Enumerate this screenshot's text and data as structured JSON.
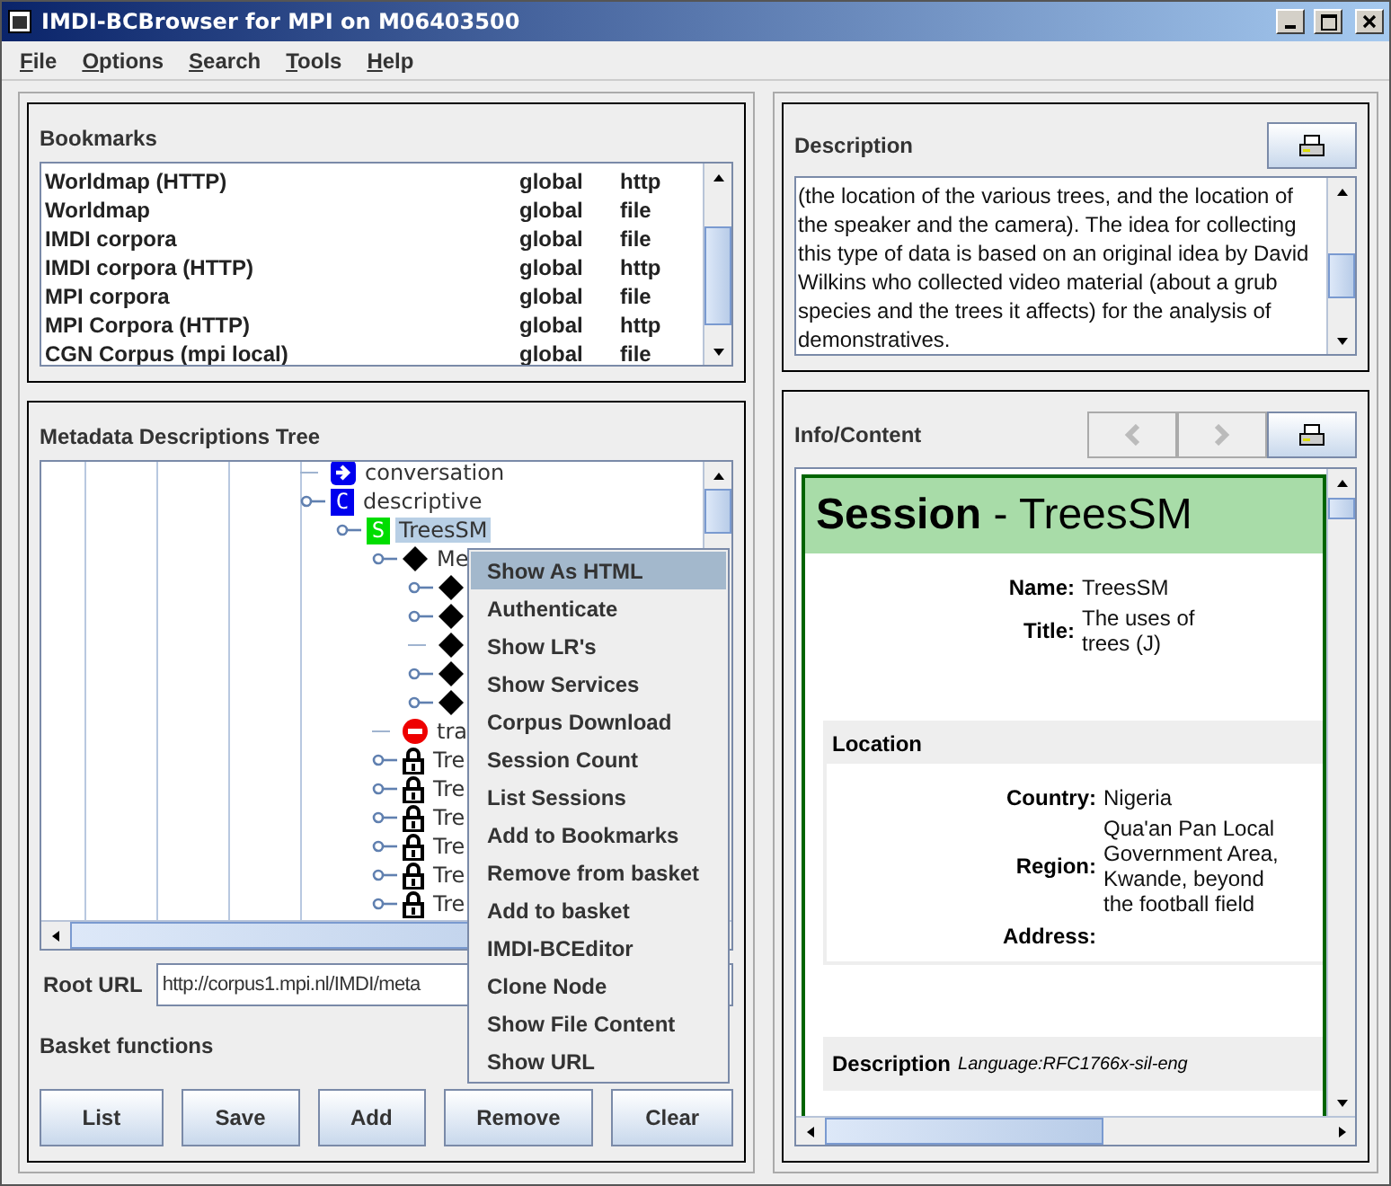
{
  "window": {
    "title": "IMDI-BCBrowser for MPI on M06403500"
  },
  "menu": [
    {
      "label": "File"
    },
    {
      "label": "Options"
    },
    {
      "label": "Search"
    },
    {
      "label": "Tools"
    },
    {
      "label": "Help"
    }
  ],
  "bookmarks": {
    "title": "Bookmarks",
    "rows": [
      {
        "name": "Worldmap (HTTP)",
        "scope": "global",
        "type": "http"
      },
      {
        "name": "Worldmap",
        "scope": "global",
        "type": "file"
      },
      {
        "name": "IMDI corpora",
        "scope": "global",
        "type": "file"
      },
      {
        "name": "IMDI corpora (HTTP)",
        "scope": "global",
        "type": "http"
      },
      {
        "name": "MPI corpora",
        "scope": "global",
        "type": "file"
      },
      {
        "name": "MPI Corpora (HTTP)",
        "scope": "global",
        "type": "http"
      },
      {
        "name": "CGN Corpus (mpi local)",
        "scope": "global",
        "type": "file"
      }
    ]
  },
  "tree": {
    "title": "Metadata Descriptions Tree",
    "nodes": [
      {
        "kind": "link",
        "label": "conversation",
        "expandable": false,
        "selected": false
      },
      {
        "kind": "corpus",
        "badge": "C",
        "label": "descriptive",
        "expandable": true,
        "selected": false,
        "children": [
          {
            "kind": "session",
            "badge": "S",
            "label": "TreesSM",
            "expandable": true,
            "selected": true,
            "children": [
              {
                "kind": "metadata",
                "label": "Me",
                "expandable": true,
                "selected": false,
                "children": [
                  {
                    "kind": "metadata",
                    "expandable": true
                  },
                  {
                    "kind": "metadata",
                    "expandable": true
                  },
                  {
                    "kind": "metadata",
                    "expandable": false
                  },
                  {
                    "kind": "metadata",
                    "expandable": true
                  },
                  {
                    "kind": "metadata",
                    "expandable": true
                  }
                ]
              },
              {
                "kind": "blocked",
                "label": "tra",
                "expandable": false,
                "selected": false
              },
              {
                "kind": "locked",
                "label": "Tre",
                "expandable": true,
                "selected": false
              },
              {
                "kind": "locked",
                "label": "Tre",
                "expandable": true,
                "selected": false
              },
              {
                "kind": "locked",
                "label": "Tre",
                "expandable": true,
                "selected": false
              },
              {
                "kind": "locked",
                "label": "Tre",
                "expandable": true,
                "selected": false
              },
              {
                "kind": "locked",
                "label": "Tre",
                "expandable": true,
                "selected": false
              },
              {
                "kind": "locked",
                "label": "Tre",
                "expandable": true,
                "selected": false
              }
            ]
          }
        ]
      }
    ]
  },
  "root_url": {
    "label": "Root URL",
    "value": "http://corpus1.mpi.nl/IMDI/meta"
  },
  "basket": {
    "title": "Basket functions",
    "buttons": [
      "List",
      "Save",
      "Add",
      "Remove",
      "Clear"
    ]
  },
  "context_menu": {
    "items": [
      {
        "label": "Show As HTML",
        "selected": true
      },
      {
        "label": "Authenticate",
        "selected": false
      },
      {
        "label": "Show LR's",
        "selected": false
      },
      {
        "label": "Show Services",
        "selected": false
      },
      {
        "label": "Corpus Download",
        "selected": false
      },
      {
        "label": "Session Count",
        "selected": false
      },
      {
        "label": "List Sessions",
        "selected": false
      },
      {
        "label": "Add to Bookmarks",
        "selected": false
      },
      {
        "label": "Remove from basket",
        "selected": false
      },
      {
        "label": "Add to basket",
        "selected": false
      },
      {
        "label": "IMDI-BCEditor",
        "selected": false
      },
      {
        "label": "Clone Node",
        "selected": false
      },
      {
        "label": "Show File Content",
        "selected": false
      },
      {
        "label": "Show URL",
        "selected": false
      }
    ]
  },
  "description": {
    "title": "Description",
    "text": "(the location of the various trees, and the location of the speaker and the camera).  The idea for collecting this type of data is based on an original idea by David Wilkins who collected video material (about a grub species and the trees it affects) for the analysis of demonstratives."
  },
  "info": {
    "title": "Info/Content",
    "nav": [
      {
        "kind": "back",
        "disabled": true
      },
      {
        "kind": "forward",
        "disabled": true
      }
    ],
    "document": {
      "heading": "**Session** - TreesSM",
      "fields": [
        {
          "label": "Name:",
          "value": "TreesSM"
        },
        {
          "label": "Title:",
          "value": "The uses of trees (J)"
        }
      ],
      "location": {
        "title": "Location",
        "fields": [
          {
            "label": "Country:",
            "value": "Nigeria"
          },
          {
            "label": "Region:",
            "value": "Qua'an Pan Local Government Area, Kwande, beyond the football field"
          },
          {
            "label": "Address:"
          }
        ]
      },
      "description": {
        "title": "Description",
        "language": "Language:RFC1766x-sil-eng"
      }
    }
  }
}
